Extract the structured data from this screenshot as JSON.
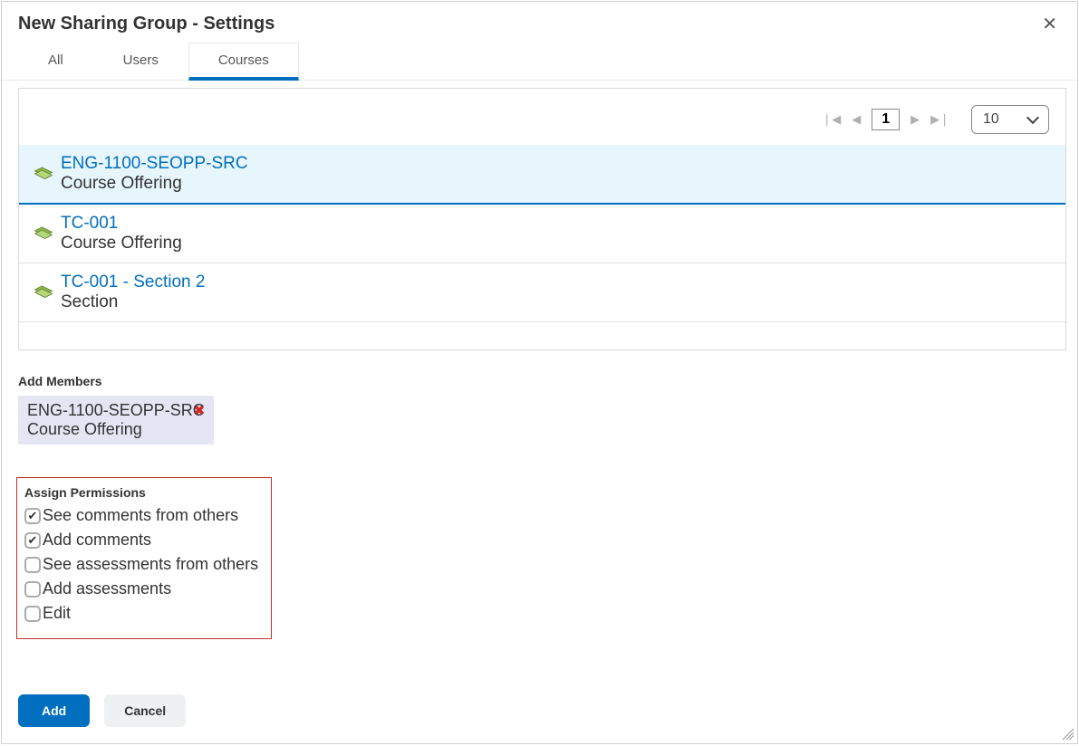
{
  "dialog": {
    "title": "New Sharing Group - Settings"
  },
  "tabs": [
    {
      "label": "All",
      "active": false
    },
    {
      "label": "Users",
      "active": false
    },
    {
      "label": "Courses",
      "active": true
    }
  ],
  "pager": {
    "page": "1",
    "page_size": "10"
  },
  "courses": [
    {
      "name": "ENG-1100-SEOPP-SRC",
      "type": "Course Offering",
      "selected": true,
      "icon": "book"
    },
    {
      "name": "TC-001",
      "type": "Course Offering",
      "selected": false,
      "icon": "book"
    },
    {
      "name": "TC-001 - Section 2",
      "type": "Section",
      "selected": false,
      "icon": "book"
    }
  ],
  "add_members": {
    "heading": "Add Members",
    "items": [
      {
        "title": "ENG-1100-SEOPP-SRC",
        "subtitle": "Course Offering"
      }
    ]
  },
  "permissions": {
    "heading": "Assign Permissions",
    "items": [
      {
        "label": "See comments from others",
        "checked": true
      },
      {
        "label": "Add comments",
        "checked": true
      },
      {
        "label": "See assessments from others",
        "checked": false
      },
      {
        "label": "Add assessments",
        "checked": false
      },
      {
        "label": "Edit",
        "checked": false
      }
    ]
  },
  "footer": {
    "primary": "Add",
    "secondary": "Cancel"
  }
}
